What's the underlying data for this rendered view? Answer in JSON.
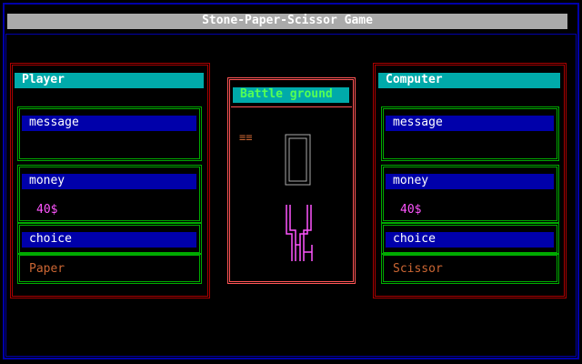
{
  "app": {
    "title": "Stone-Paper-Scissor Game"
  },
  "player": {
    "heading": "Player",
    "message_label": "message",
    "message_value": "",
    "money_label": "money",
    "money_value": "40$",
    "choice_label": "choice",
    "choice_value": "Paper"
  },
  "arena": {
    "heading": "Battle ground",
    "marker": "≡≡"
  },
  "computer": {
    "heading": "Computer",
    "message_label": "message",
    "message_value": "",
    "money_label": "money",
    "money_value": "40$",
    "choice_label": "choice",
    "choice_value": "Scissor"
  },
  "colors": {
    "frame": "#0000aa",
    "title_bar": "#aaaaaa",
    "panel_border": "#aa0000",
    "arena_border": "#ff5555",
    "header_bg": "#00aaaa",
    "label_bg": "#0000aa",
    "money_text": "#ff55ff",
    "choice_text": "#cc6633",
    "paper_glyph": "#aaaaaa",
    "scissor_glyph": "#ff55ff"
  },
  "icons": [
    "paper-hand-icon",
    "scissor-hand-icon",
    "marker-icon"
  ]
}
